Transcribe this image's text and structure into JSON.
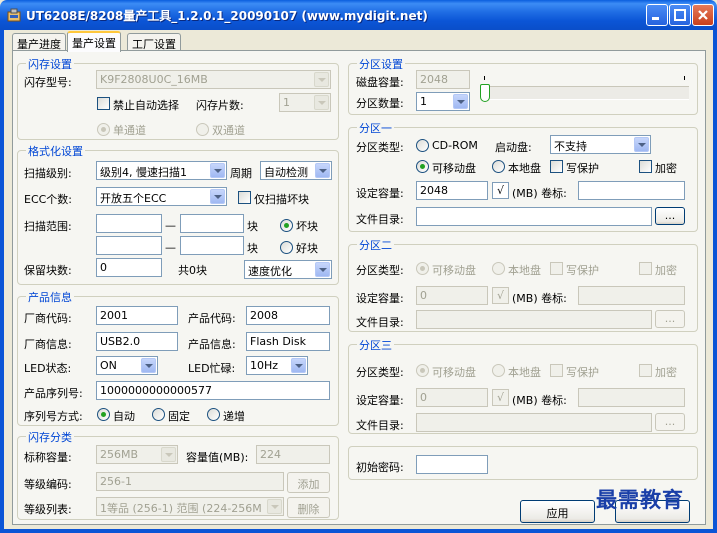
{
  "window": {
    "title": "UT6208E/8208量产工具_1.2.0.1_20090107 (www.mydigit.net)"
  },
  "tabs": [
    "量产进度",
    "量产设置",
    "工厂设置"
  ],
  "flash_settings": {
    "legend": "闪存设置",
    "model_label": "闪存型号:",
    "model_value": "K9F2808U0C_16MB",
    "disable_auto_label": "禁止自动选择",
    "chip_count_label": "闪存片数:",
    "chip_count_value": "1",
    "single_channel": "单通道",
    "dual_channel": "双通道"
  },
  "format_settings": {
    "legend": "格式化设置",
    "scan_level_label": "扫描级别:",
    "scan_level_value": "级别4, 慢速扫描1",
    "period_label": "周期",
    "period_value": "自动检测",
    "ecc_label": "ECC个数:",
    "ecc_value": "开放五个ECC",
    "only_scan_bad_label": "仅扫描坏块",
    "scan_range_label": "扫描范围:",
    "dash": "—",
    "block_label": "块",
    "bad_block": "坏块",
    "good_block": "好块",
    "reserved_label": "保留块数:",
    "reserved_value": "0",
    "reserved_total": "共0块",
    "speed_value": "速度优化"
  },
  "product_info": {
    "legend": "产品信息",
    "vendor_code_label": "厂商代码:",
    "vendor_code_value": "2001",
    "product_code_label": "产品代码:",
    "product_code_value": "2008",
    "vendor_info_label": "厂商信息:",
    "vendor_info_value": "USB2.0",
    "product_info_label": "产品信息:",
    "product_info_value": "Flash Disk",
    "led_state_label": "LED状态:",
    "led_state_value": "ON",
    "led_busy_label": "LED忙碌:",
    "led_busy_value": "10Hz",
    "serial_label": "产品序列号:",
    "serial_value": "1000000000000577",
    "serial_mode_label": "序列号方式:",
    "serial_auto": "自动",
    "serial_fixed": "固定",
    "serial_increment": "递增"
  },
  "flash_class": {
    "legend": "闪存分类",
    "nominal_label": "标称容量:",
    "nominal_value": "256MB",
    "capacity_label": "容量值(MB):",
    "capacity_value": "224",
    "grade_code_label": "等级编码:",
    "grade_code_value": "256-1",
    "add_button": "添加",
    "grade_list_label": "等级列表:",
    "grade_list_value": "1等品 (256-1) 范围 (224-256M",
    "delete_button": "删除"
  },
  "partition_settings": {
    "legend": "分区设置",
    "disk_capacity_label": "磁盘容量:",
    "disk_capacity_value": "2048",
    "partition_count_label": "分区数量:",
    "partition_count_value": "1",
    "slider_fraction": 0
  },
  "partition1": {
    "legend": "分区一",
    "type_label": "分区类型:",
    "cdrom": "CD-ROM",
    "boot_label": "启动盘:",
    "boot_value": "不支持",
    "removable": "可移动盘",
    "local": "本地盘",
    "write_protect": "写保护",
    "encrypt": "加密",
    "capacity_label": "设定容量:",
    "capacity_value": "2048",
    "check_mark": "√",
    "mb_label": "(MB) 卷标:",
    "volume_value": "",
    "dir_label": "文件目录:",
    "dir_value": "",
    "browse": "..."
  },
  "partition2": {
    "legend": "分区二",
    "type_label": "分区类型:",
    "removable": "可移动盘",
    "local": "本地盘",
    "write_protect": "写保护",
    "encrypt": "加密",
    "capacity_label": "设定容量:",
    "capacity_value": "0",
    "check_mark": "√",
    "mb_label": "(MB) 卷标:",
    "dir_label": "文件目录:",
    "browse": "..."
  },
  "partition3": {
    "legend": "分区三",
    "type_label": "分区类型:",
    "removable": "可移动盘",
    "local": "本地盘",
    "write_protect": "写保护",
    "encrypt": "加密",
    "capacity_label": "设定容量:",
    "capacity_value": "0",
    "check_mark": "√",
    "mb_label": "(MB) 卷标:",
    "dir_label": "文件目录:",
    "browse": "..."
  },
  "password": {
    "label": "初始密码:",
    "value": ""
  },
  "footer": {
    "apply_button": "应用",
    "watermark": "最需教育"
  }
}
